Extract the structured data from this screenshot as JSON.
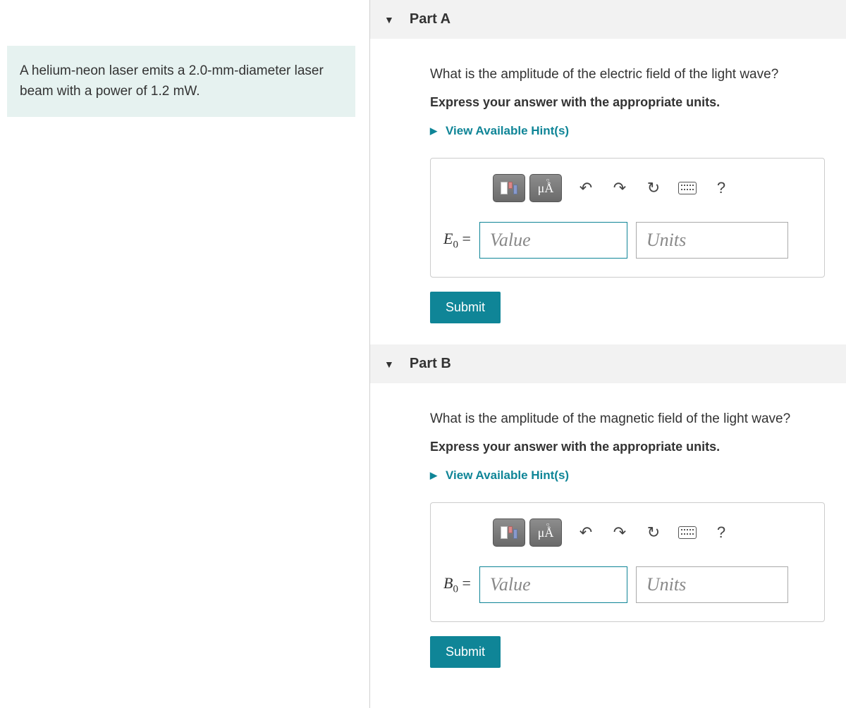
{
  "problem_text": "A helium-neon laser emits a 2.0-mm-diameter laser beam with a power of 1.2 mW.",
  "partA": {
    "title": "Part A",
    "question": "What is the amplitude of the electric field of the light wave?",
    "instruction": "Express your answer with the appropriate units.",
    "hints_label": "View Available Hint(s)",
    "var_symbol": "E",
    "var_sub": "0",
    "eq": " = ",
    "value_placeholder": "Value",
    "units_placeholder": "Units",
    "submit_label": "Submit"
  },
  "partB": {
    "title": "Part B",
    "question": "What is the amplitude of the magnetic field of the light wave?",
    "instruction": "Express your answer with the appropriate units.",
    "hints_label": "View Available Hint(s)",
    "var_symbol": "B",
    "var_sub": "0",
    "eq": " = ",
    "value_placeholder": "Value",
    "units_placeholder": "Units",
    "submit_label": "Submit"
  },
  "toolbar_help": "?"
}
